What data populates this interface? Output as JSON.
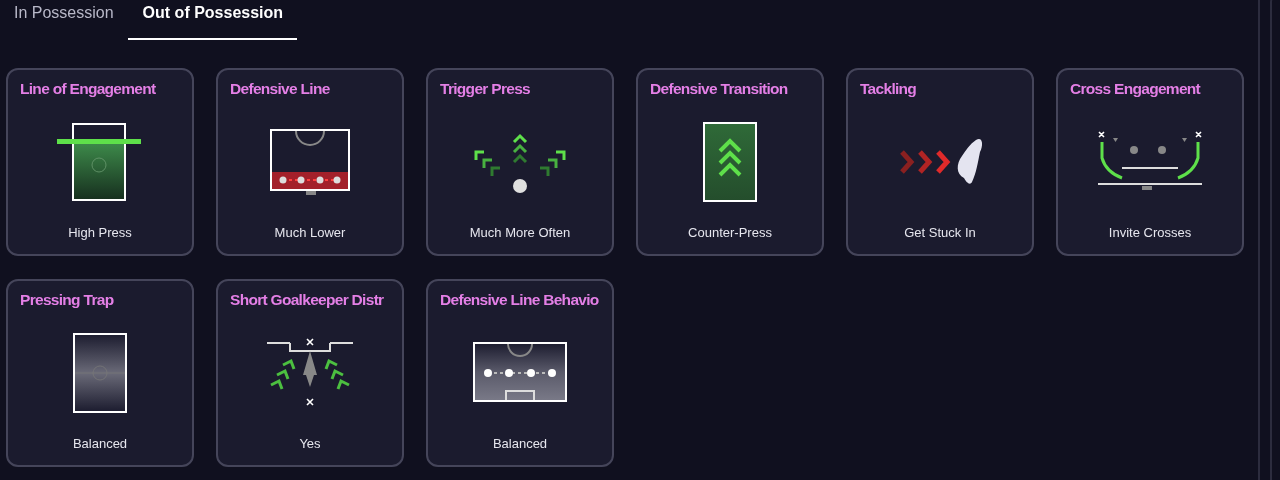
{
  "tabs": [
    {
      "label": "In Possession",
      "selected": false
    },
    {
      "label": "Out of Possession",
      "selected": true
    }
  ],
  "cards": [
    {
      "title": "Line of Engagement",
      "value": "High Press",
      "kind": "engagement"
    },
    {
      "title": "Defensive Line",
      "value": "Much Lower",
      "kind": "defline"
    },
    {
      "title": "Trigger Press",
      "value": "Much More Often",
      "kind": "trigger"
    },
    {
      "title": "Defensive Transition",
      "value": "Counter-Press",
      "kind": "transition"
    },
    {
      "title": "Tackling",
      "value": "Get Stuck In",
      "kind": "tackling"
    },
    {
      "title": "Cross Engagement",
      "value": "Invite Crosses",
      "kind": "cross"
    },
    {
      "title": "Pressing Trap",
      "value": "Balanced",
      "kind": "trap"
    },
    {
      "title": "Short Goalkeeper Distr",
      "value": "Yes",
      "kind": "distribution"
    },
    {
      "title": "Defensive Line Behavio",
      "value": "Balanced",
      "kind": "behaviour"
    }
  ]
}
